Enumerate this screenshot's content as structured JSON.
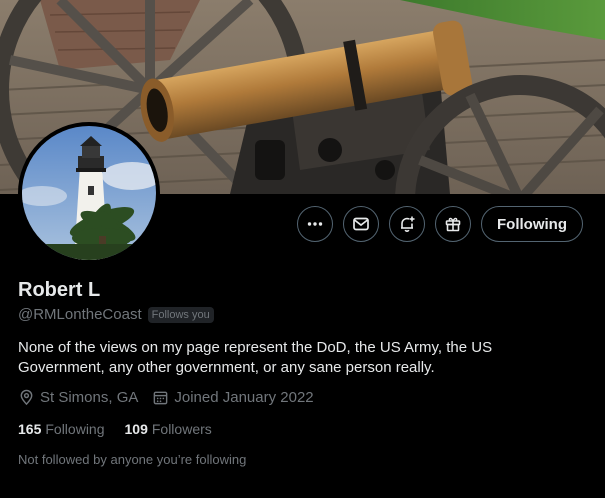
{
  "profile": {
    "display_name": "Robert L",
    "handle": "@RMLontheCoast",
    "follows_you_badge": "Follows you",
    "bio": "None of the views on my page represent the DoD, the US Army, the US Government, any other government, or any sane person really.",
    "location": "St Simons, GA",
    "joined": "Joined January 2022",
    "following_count": "165",
    "following_label": "Following",
    "followers_count": "109",
    "followers_label": "Followers",
    "mutual_text": "Not followed by anyone you’re following"
  },
  "actions": {
    "more_icon": "more-horizontal-icon",
    "message_icon": "envelope-icon",
    "notify_icon": "bell-plus-icon",
    "subscribe_icon": "gift-icon",
    "follow_label": "Following"
  },
  "colors": {
    "background": "#000000",
    "text_primary": "#e7e9ea",
    "text_secondary": "#71767b",
    "border": "#536471",
    "badge_bg": "#202327"
  }
}
